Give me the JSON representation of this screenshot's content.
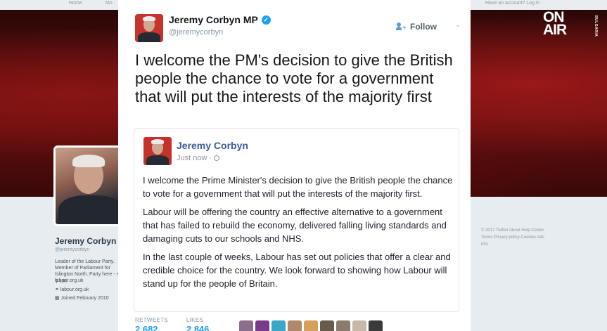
{
  "channel_logo": {
    "line1": "ON",
    "line2": "AIR",
    "side": "BULGARIA"
  },
  "background": {
    "topbar": {
      "nav_item": "Home",
      "nav_item_2": "Mo",
      "right_text": "Have an account? Log in"
    },
    "profile": {
      "name": "Jeremy Corbyn",
      "handle": "@jeremycorbyn",
      "bio": "Leader of the Labour Party. Member of Parliament for Islington North. Party here - + labour.org.uk",
      "location": "UK",
      "website": "labour.org.uk",
      "joined": "Joined February 2010"
    },
    "footer_links": "© 2017 Twitter  About  Help Center  Terms  Privacy policy  Cookies  Ads info"
  },
  "tweet": {
    "author_name": "Jeremy Corbyn MP",
    "handle": "@jeremycorbyn",
    "verified": true,
    "follow_label": "Follow",
    "text": "I welcome the PM's decision to give the British people the chance to vote for a government that will put the interests of the majority first",
    "quoted_post": {
      "author_name": "Jeremy Corbyn",
      "timestamp": "Just now",
      "paragraphs": [
        "I welcome the Prime Minister's decision to give the British people the chance to vote for a government that will put the interests of the majority first.",
        "Labour will be offering the country an effective alternative to a government that has failed to rebuild the economy, delivered falling living standards and damaging cuts to our schools and NHS.",
        "In the last couple of weeks, Labour has set out policies that offer a clear and credible choice for the country. We look forward to showing how Labour will stand up for the people of Britain."
      ]
    },
    "stats": {
      "retweets_label": "RETWEETS",
      "retweets_value": "2,682",
      "likes_label": "LIKES",
      "likes_value": "2,846"
    },
    "liker_colors": [
      "#8a6e8c",
      "#7a3b8c",
      "#3aa6c8",
      "#b0876a",
      "#d4a15a",
      "#6a5a4a",
      "#8c7a6e",
      "#c9b8a8",
      "#3a3a3a"
    ]
  }
}
